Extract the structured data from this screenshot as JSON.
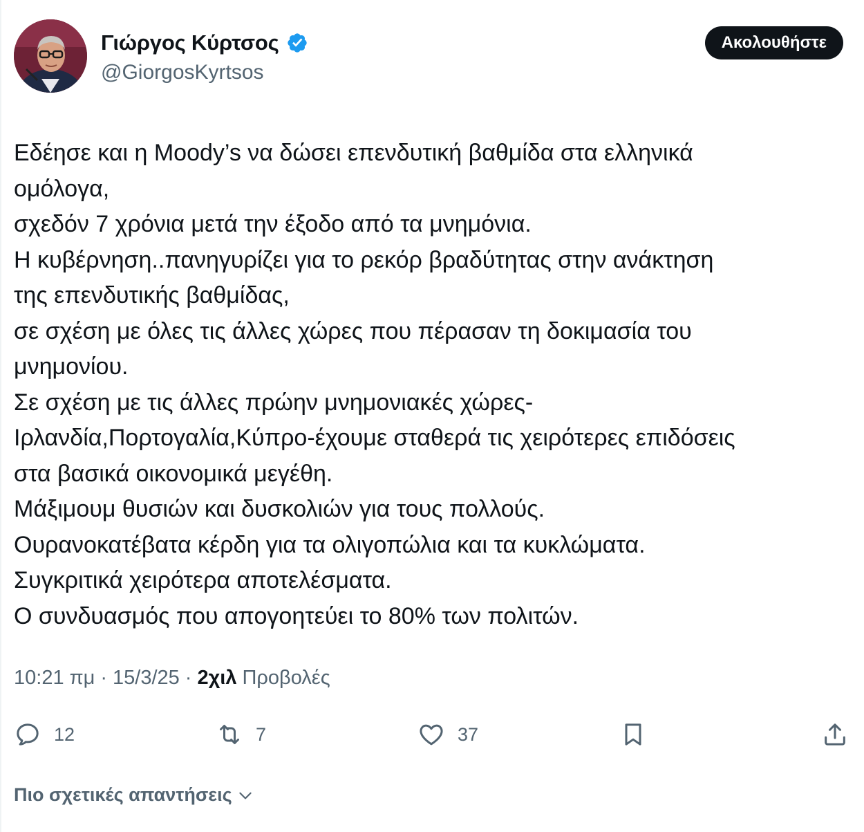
{
  "author": {
    "name": "Γιώργος Κύρτσος",
    "handle": "@GiorgosKyrtsos",
    "verified": true
  },
  "follow_button": {
    "label": "Ακολουθήστε"
  },
  "tweet": {
    "lines": [
      "Εδέησε και η Moody’s να δώσει επενδυτική βαθμίδα στα ελληνικά",
      "ομόλογα,",
      "σχεδόν 7 χρόνια μετά την έξοδο από τα μνημόνια.",
      "Η κυβέρνηση..πανηγυρίζει για το ρεκόρ βραδύτητας στην ανάκτηση",
      "της επενδυτικής βαθμίδας,",
      "σε σχέση με όλες τις άλλες χώρες που πέρασαν τη δοκιμασία του",
      "μνημονίου.",
      "Σε σχέση με τις άλλες πρώην μνημονιακές χώρες-",
      "Ιρλανδία,Πορτογαλία,Κύπρο-έχουμε σταθερά τις χειρότερες επιδόσεις",
      "στα βασικά οικονομικά μεγέθη.",
      "Μάξιμουμ θυσιών και δυσκολιών για τους πολλούς.",
      "Ουρανοκατέβατα κέρδη για τα ολιγοπώλια και τα κυκλώματα.",
      "Συγκριτικά χειρότερα αποτελέσματα.",
      "Ο συνδυασμός που απογοητεύει το 80% των πολιτών."
    ]
  },
  "meta": {
    "time": "10:21 πμ",
    "separator": "·",
    "date": "15/3/25",
    "views_count": "2χιλ",
    "views_label": "Προβολές"
  },
  "actions": {
    "replies": "12",
    "reposts": "7",
    "likes": "37"
  },
  "more_replies": {
    "label": "Πιο σχετικές απαντήσεις"
  },
  "colors": {
    "text": "#0f1419",
    "secondary": "#536471",
    "verified_blue": "#1d9bf0",
    "button_bg": "#0f1419"
  },
  "icons": [
    "verified-badge-icon",
    "reply-icon",
    "repost-icon",
    "like-icon",
    "bookmark-icon",
    "share-icon",
    "chevron-down-icon"
  ]
}
